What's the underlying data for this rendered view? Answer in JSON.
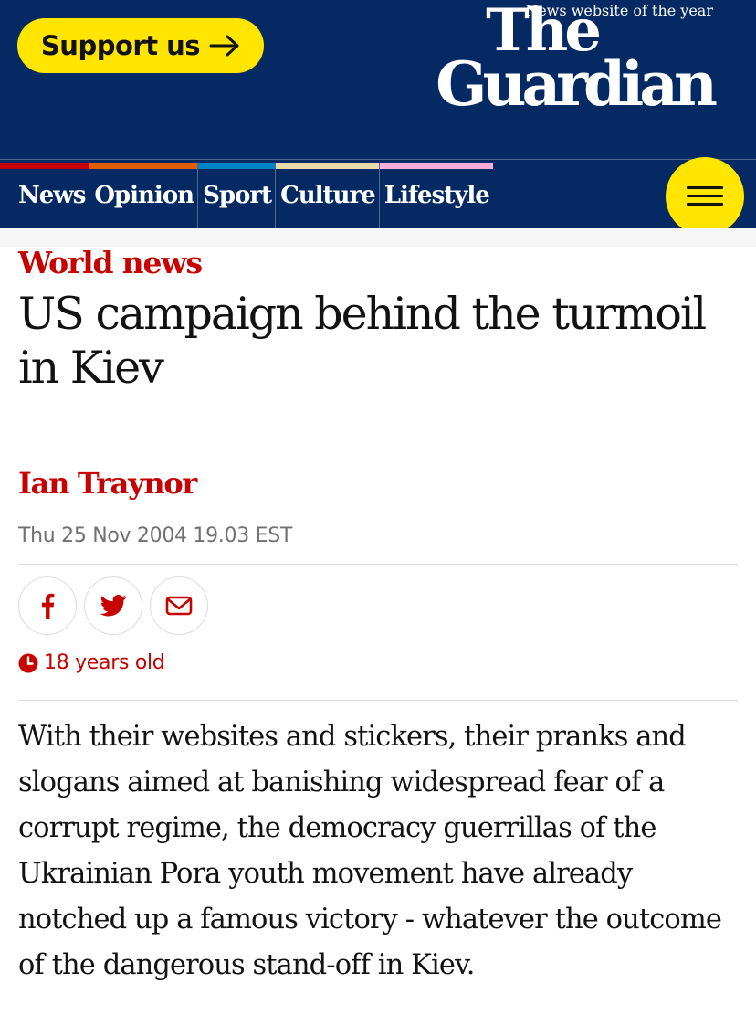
{
  "header": {
    "support_label": "Support us",
    "logo_line1": "The",
    "logo_line2": "Guardian",
    "logo_tagline": "News website of the year",
    "brand_color": "#052962",
    "accent_color": "#ffe500"
  },
  "nav": {
    "pillars": [
      {
        "label": "News",
        "color": "#c70000"
      },
      {
        "label": "Opinion",
        "color": "#e05e00"
      },
      {
        "label": "Sport",
        "color": "#0084c6"
      },
      {
        "label": "Culture",
        "color": "#a1845c"
      },
      {
        "label": "Lifestyle",
        "color": "#bb3b80"
      }
    ],
    "menu_icon": "hamburger-icon"
  },
  "article": {
    "section": "World news",
    "headline": "US campaign behind the turmoil in Kiev",
    "byline": "Ian Traynor",
    "dateline": "Thu 25 Nov 2004 19.03 EST",
    "share_icons": [
      "facebook-icon",
      "twitter-icon",
      "email-icon"
    ],
    "age_label": "18 years old",
    "standfirst": "With their websites and stickers, their pranks and slogans aimed at banishing widespread fear of a corrupt regime, the democracy guerrillas of the Ukrainian Pora youth movement have already notched up a famous victory - whatever the outcome of the dangerous stand-off in Kiev."
  }
}
